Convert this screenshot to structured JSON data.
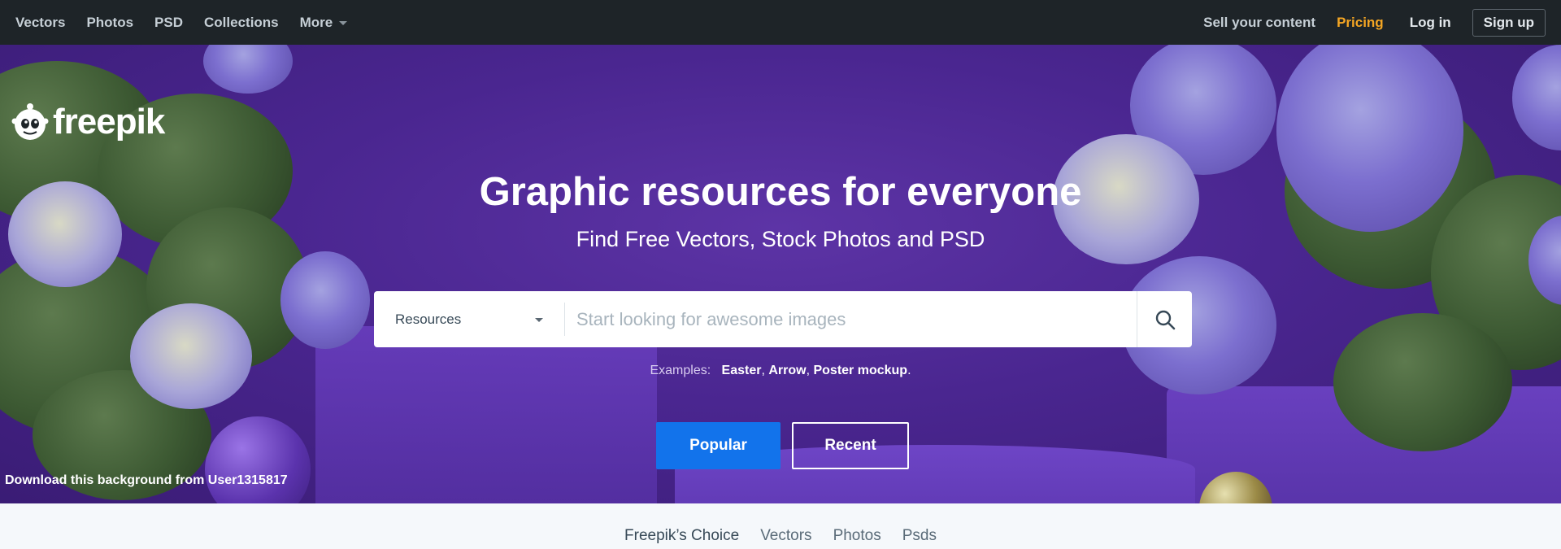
{
  "topnav": {
    "left": [
      {
        "label": "Vectors"
      },
      {
        "label": "Photos"
      },
      {
        "label": "PSD"
      },
      {
        "label": "Collections"
      },
      {
        "label": "More"
      }
    ],
    "sell_label": "Sell your content",
    "pricing_label": "Pricing",
    "login_label": "Log in",
    "signup_label": "Sign up",
    "pricing_color": "#f5a623"
  },
  "logo": {
    "text": "freepik"
  },
  "hero": {
    "title": "Graphic resources for everyone",
    "subtitle": "Find Free Vectors, Stock Photos and PSD",
    "credit": "Download this background from User1315817"
  },
  "search": {
    "category": "Resources",
    "placeholder": "Start looking for awesome images",
    "button_icon": "search-icon"
  },
  "examples": {
    "label": "Examples:",
    "items": [
      "Easter",
      "Arrow",
      "Poster mockup"
    ]
  },
  "buttons": {
    "popular": "Popular",
    "recent": "Recent",
    "popular_color": "#1273eb"
  },
  "tabs": [
    {
      "label": "Freepik’s Choice"
    },
    {
      "label": "Vectors"
    },
    {
      "label": "Photos"
    },
    {
      "label": "Psds"
    }
  ]
}
